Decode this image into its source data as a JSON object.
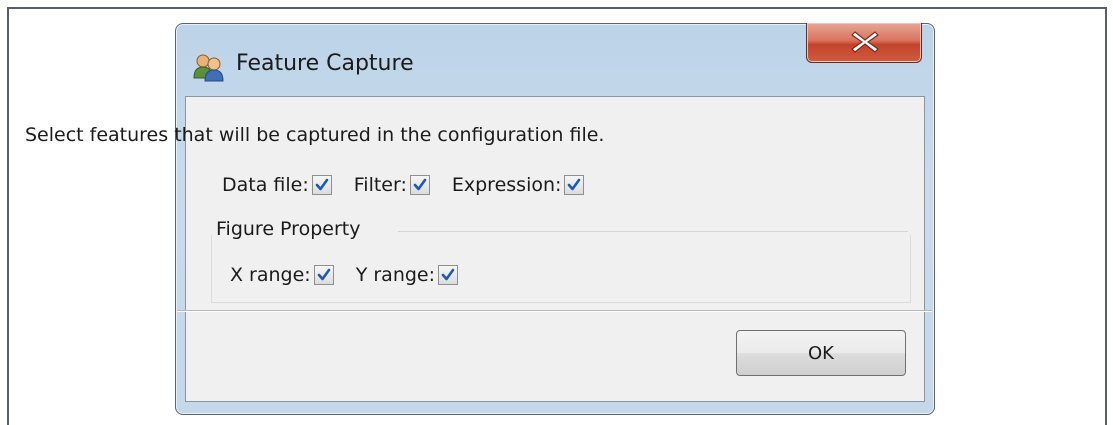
{
  "dialog": {
    "title": "Feature Capture",
    "icon": "users-icon",
    "close_icon": "close-icon"
  },
  "instruction": "Select features that will be captured in the configuration file.",
  "features": [
    {
      "label": "Data file:",
      "checked": true
    },
    {
      "label": "Filter:",
      "checked": true
    },
    {
      "label": "Expression:",
      "checked": true
    }
  ],
  "figure_property": {
    "title": "Figure Property",
    "items": [
      {
        "label": "X range:",
        "checked": true
      },
      {
        "label": "Y range:",
        "checked": true
      }
    ]
  },
  "buttons": {
    "ok_label": "OK"
  },
  "colors": {
    "checkmark": "#1d57b8",
    "close_button": "#c4432a",
    "titlebar": "#bcd3e8"
  }
}
